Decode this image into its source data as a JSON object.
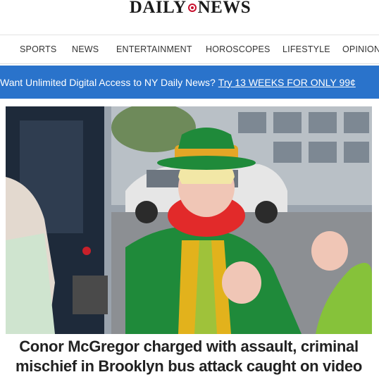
{
  "masthead": {
    "logo_left": "DAILY",
    "logo_right": "NEWS",
    "logo_emblem_icon": "daily-news-emblem-icon"
  },
  "nav": {
    "items": [
      "SPORTS",
      "NEWS",
      "ENTERTAINMENT",
      "HOROSCOPES",
      "LIFESTYLE",
      "OPINION"
    ]
  },
  "promo": {
    "text": "Want Unlimited Digital Access to NY Daily News?",
    "link": "Try 13 WEEKS FOR ONLY 99¢",
    "background_color": "#2a73cb"
  },
  "article": {
    "image_icon": "article-photo",
    "headline": "Conor McGregor charged with assault, criminal mischief in Brooklyn bus attack caught on video"
  }
}
